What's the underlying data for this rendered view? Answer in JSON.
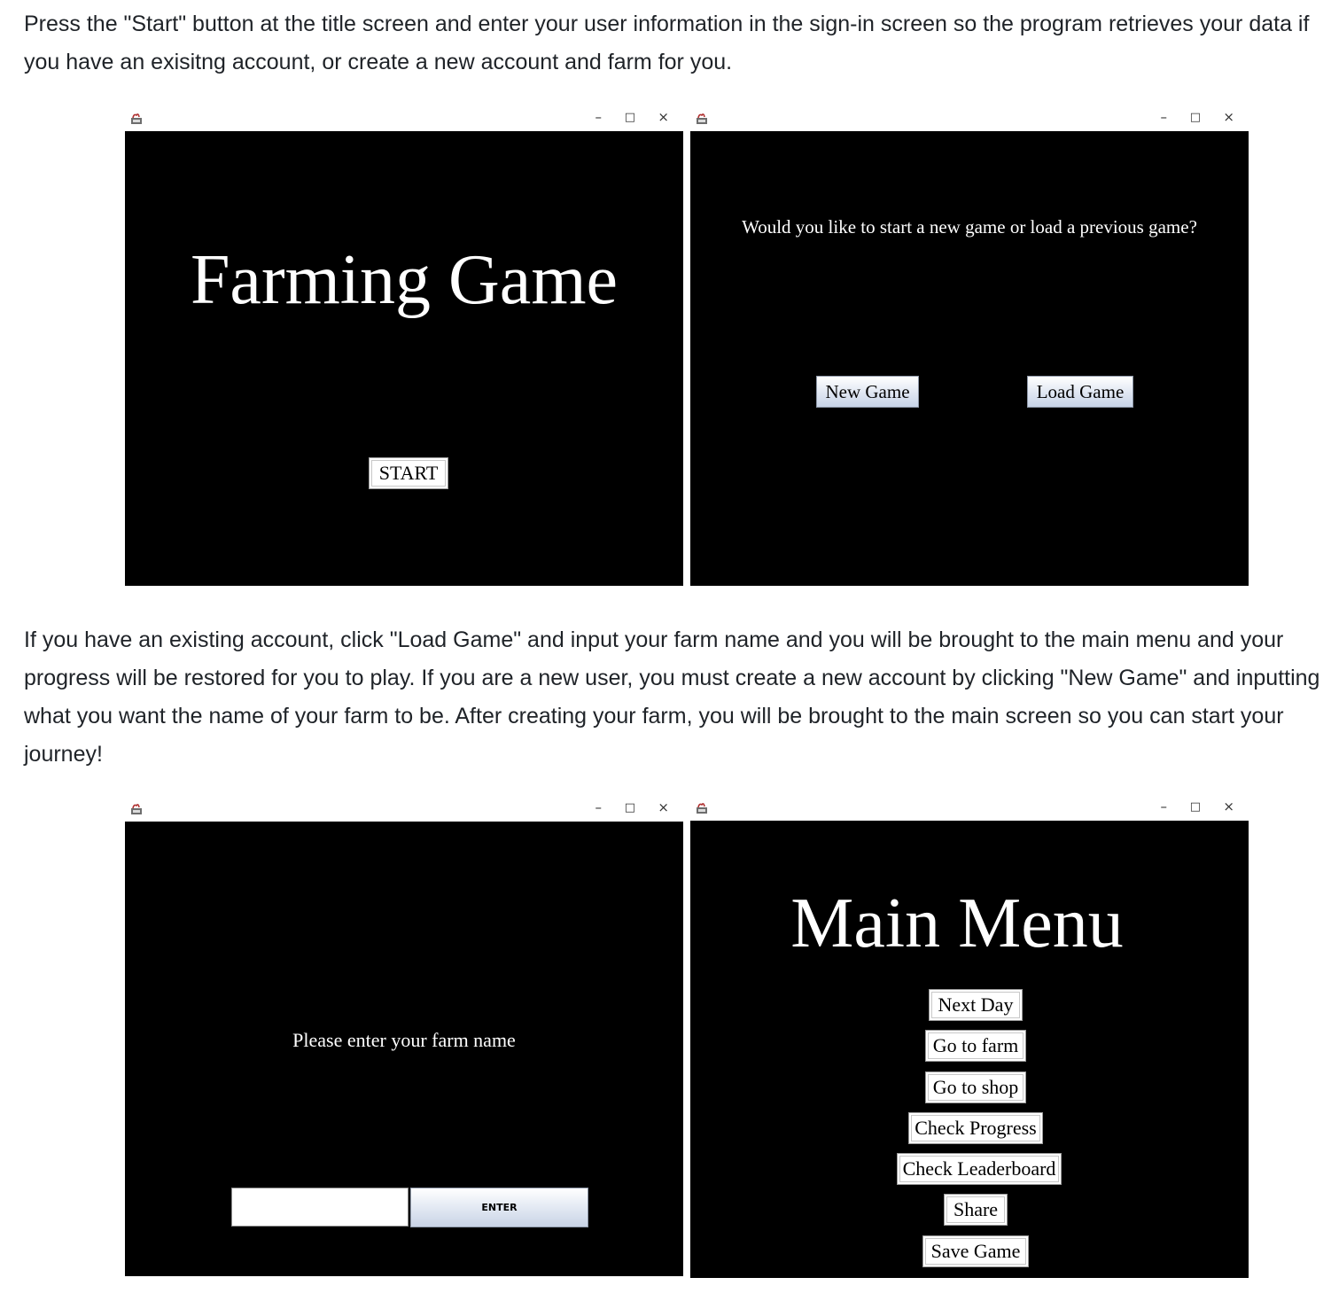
{
  "paragraphs": {
    "intro": "Press the \"Start\" button at the title screen and enter your user information in the sign-in screen so the program retrieves your data if you have an exisitng account, or create a new account and farm for you.",
    "accounts": "If you have an existing account, click \"Load Game\" and input your farm name and you will be brought to the main menu and your progress will be restored for you to play. If you are a new user, you must create a new account by clicking \"New Game\" and inputting what you want the name of your farm to be. After creating your farm, you will be brought to the main screen so you can start your journey!"
  },
  "window_controls": {
    "minimize": "–",
    "maximize": "□",
    "close": "×"
  },
  "title_screen": {
    "title": "Farming Game",
    "start_label": "START"
  },
  "load_screen": {
    "question": "Would you like to start a new game or load a previous game?",
    "new_game_label": "New Game",
    "load_game_label": "Load Game"
  },
  "name_screen": {
    "prompt": "Please enter your farm name",
    "input_value": "",
    "enter_label": "ENTER"
  },
  "main_menu": {
    "title": "Main Menu",
    "buttons": [
      "Next Day",
      "Go to farm",
      "Go to shop",
      "Check Progress",
      "Check Leaderboard",
      "Share",
      "Save Game"
    ]
  },
  "icons": {
    "app": "java-app-icon"
  }
}
